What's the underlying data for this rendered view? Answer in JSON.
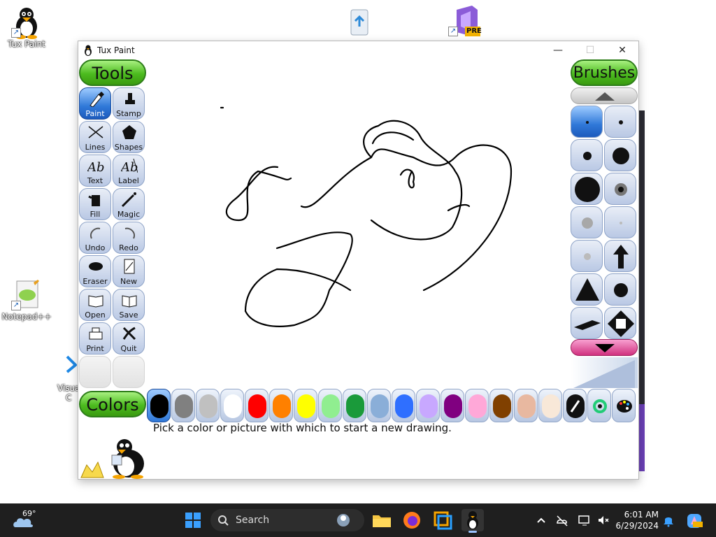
{
  "desktop": {
    "icons": [
      {
        "label": "Tux Paint"
      },
      {
        "label": "Notepad++"
      },
      {
        "label": "Visua C"
      }
    ],
    "pre_badge": "PRE"
  },
  "window": {
    "title": "Tux Paint",
    "controls": {
      "minimize": "—",
      "maximize": "☐",
      "close": "✕"
    }
  },
  "tools": {
    "header": "Tools",
    "items": [
      {
        "label": "Paint",
        "icon": "paintbrush-icon",
        "selected": true
      },
      {
        "label": "Stamp",
        "icon": "stamp-icon"
      },
      {
        "label": "Lines",
        "icon": "lines-icon"
      },
      {
        "label": "Shapes",
        "icon": "pentagon-icon"
      },
      {
        "label": "Text",
        "icon": "text-icon"
      },
      {
        "label": "Label",
        "icon": "label-icon"
      },
      {
        "label": "Fill",
        "icon": "paint-bucket-icon"
      },
      {
        "label": "Magic",
        "icon": "magic-wand-icon"
      },
      {
        "label": "Undo",
        "icon": "undo-icon"
      },
      {
        "label": "Redo",
        "icon": "redo-icon"
      },
      {
        "label": "Eraser",
        "icon": "eraser-icon"
      },
      {
        "label": "New",
        "icon": "new-page-icon"
      },
      {
        "label": "Open",
        "icon": "open-book-icon"
      },
      {
        "label": "Save",
        "icon": "save-book-icon"
      },
      {
        "label": "Print",
        "icon": "printer-icon"
      },
      {
        "label": "Quit",
        "icon": "quit-icon"
      }
    ]
  },
  "brushes": {
    "header": "Brushes"
  },
  "colors": {
    "header": "Colors",
    "swatches": [
      "#000000",
      "#808080",
      "#c0c0c0",
      "#ffffff",
      "#ff0000",
      "#ff8000",
      "#ffff00",
      "#90ee90",
      "#1a9a3a",
      "#8aaed8",
      "#2f6fff",
      "#c8a8ff",
      "#800080",
      "#ffa8d8",
      "#804000",
      "#e8b8a0",
      "#f8e8d8"
    ]
  },
  "status": {
    "message": "Pick a color or picture with which to start a new drawing."
  },
  "taskbar": {
    "weather": "69°",
    "search_placeholder": "Search",
    "time": "6:01 AM",
    "date": "6/29/2024"
  }
}
